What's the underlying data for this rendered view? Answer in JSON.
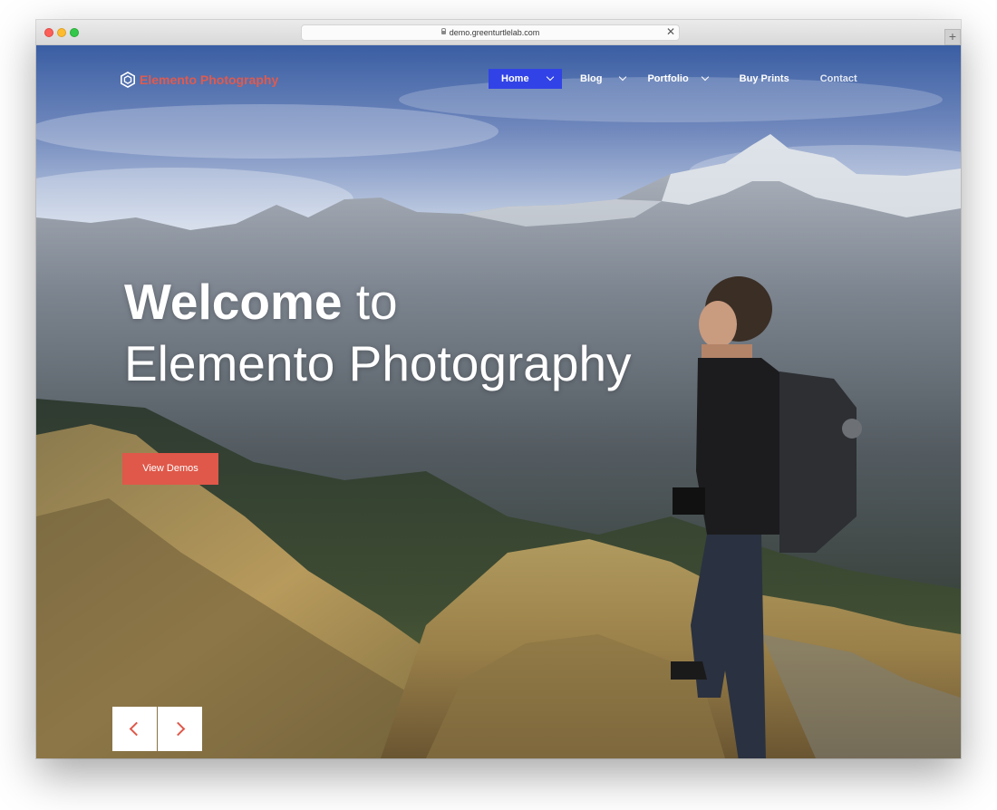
{
  "browser": {
    "url": "demo.greenturtlelab.com",
    "close_glyph": "✕",
    "new_tab_glyph": "+"
  },
  "site": {
    "logo_text": "Elemento Photography",
    "brand_color": "#e05a4e",
    "accent_color": "#3143e6"
  },
  "nav": {
    "home": "Home",
    "blog": "Blog",
    "portfolio": "Portfolio",
    "buy_prints": "Buy Prints",
    "contact": "Contact"
  },
  "hero": {
    "title_bold": "Welcome",
    "title_rest": " to",
    "title_line2": "Elemento Photography",
    "cta_label": "View Demos"
  },
  "icons": {
    "logo": "hexagon-logo-icon",
    "lock": "lock-icon",
    "prev": "chevron-left-icon",
    "next": "chevron-right-icon",
    "dropdown": "chevron-down-icon"
  }
}
